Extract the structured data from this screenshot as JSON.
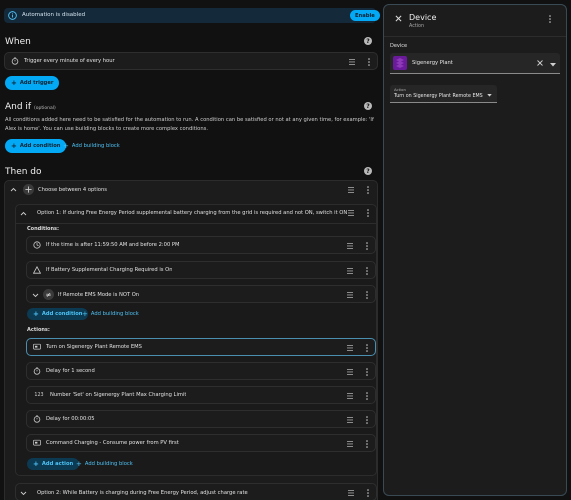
{
  "banner": {
    "text": "Automation is disabled",
    "button": "Enable"
  },
  "when": {
    "title": "When",
    "trigger": "Trigger every minute of every hour",
    "add_trigger": "Add trigger"
  },
  "and_if": {
    "title": "And if",
    "optional": "(optional)",
    "description": "All conditions added here need to be satisfied for the automation to run. A condition can be satisfied or not at any given time, for example: 'If Alex is home'. You can use building blocks to create more complex conditions.",
    "add_condition": "Add condition",
    "add_building_block": "Add building block"
  },
  "then_do": {
    "title": "Then do",
    "choose": "Choose between 4 options",
    "option1": {
      "title": "Option 1: If during Free Energy Period supplemental battery charging from the grid is required and not ON, switch it ON",
      "conditions_label": "Conditions:",
      "conditions": [
        "If the time is after 11:59:50 AM and before 2:00 PM",
        "If Battery Supplemental Charging Required is On",
        "If Remote EMS Mode is NOT On"
      ],
      "add_condition": "Add condition",
      "add_building_block": "Add building block",
      "actions_label": "Actions:",
      "actions": [
        "Turn on Sigenergy Plant Remote EMS",
        "Delay for 1 second",
        "Number 'Set' on Sigenergy Plant Max Charging Limit",
        "Delay for 00:00:05",
        "Command Charging - Consume power from PV first"
      ],
      "number_prefix": "123",
      "add_action": "Add action",
      "add_building_block2": "Add building block"
    },
    "option2": "Option 2: While Battery is charging during Free Energy Period, adjust charge rate"
  },
  "panel": {
    "title": "Device",
    "subtitle": "Action",
    "device_label": "Device",
    "device_value": "Sigenergy Plant",
    "action_label": "Action",
    "action_value": "Turn on Sigenergy Plant Remote EMS"
  },
  "colors": {
    "accent": "#03a9f4",
    "background": "#111111",
    "card": "#1c1c1c",
    "selected_border": "#4a8fb0",
    "device_icon": "#6a1b9a"
  },
  "icons": {
    "info": "info-icon",
    "timer": "timer-icon",
    "clock": "clock-icon",
    "warning": "triangle-icon",
    "not_equal": "not-equal-icon",
    "device": "device-icon",
    "drag": "drag-handle-icon",
    "more": "more-vert-icon"
  }
}
